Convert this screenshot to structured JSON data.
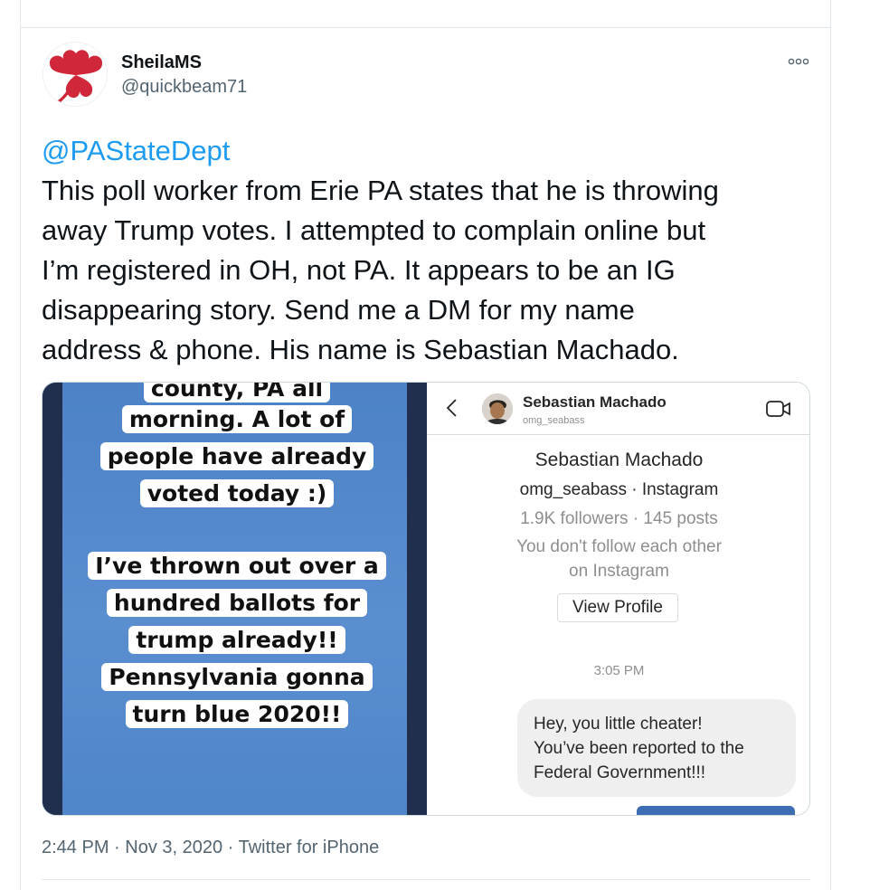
{
  "tweet": {
    "author": {
      "display_name": "SheilaMS",
      "handle": "@quickbeam71"
    },
    "mention": "@PAStateDept",
    "body_lines": [
      "This poll worker from Erie PA states that he is throwing",
      "away Trump votes. I attempted to complain online but",
      "I’m registered in OH, not PA. It appears to be an IG",
      "disappearing story. Send me a DM for my name",
      "address & phone. His name is Sebastian Machado."
    ],
    "time": "2:44 PM",
    "separator": "·",
    "date": "Nov 3, 2020",
    "source": "Twitter for iPhone"
  },
  "media": {
    "story": {
      "top_partial_line": "county, PA all",
      "block1_lines": [
        "morning. A lot of",
        "people have already",
        "voted today :)"
      ],
      "block2_lines": [
        "I’ve thrown out over a",
        "hundred ballots for",
        "trump already!!",
        "Pennsylvania gonna",
        "turn blue 2020!!"
      ]
    },
    "dm": {
      "header_name": "Sebastian Machado",
      "header_username": "omg_seabass",
      "profile_name": "Sebastian Machado",
      "profile_sub": "omg_seabass · Instagram",
      "profile_stats": "1.9K followers · 145 posts",
      "profile_follow_lines": [
        "You don't follow each other",
        "on Instagram"
      ],
      "view_profile_label": "View Profile",
      "time": "3:05 PM",
      "message_lines": [
        "Hey, you little cheater!",
        "You’ve been reported to the",
        "Federal Government!!!"
      ]
    }
  },
  "colors": {
    "link": "#1d9bf0",
    "text": "#0f1419",
    "muted": "#536471",
    "logo_red": "#d0283a",
    "story_blue": "#5a8ecf"
  },
  "icons": [
    "shamrock-avatar-icon",
    "more-icon",
    "back-chevron-icon",
    "video-call-icon"
  ]
}
